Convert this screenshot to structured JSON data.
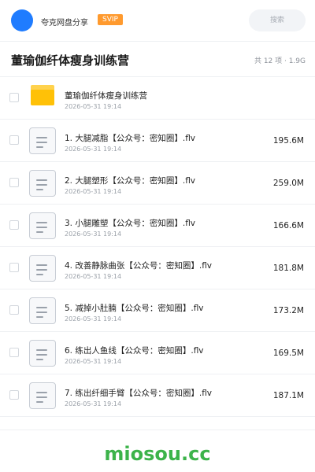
{
  "header": {
    "user_name": "夸克网盘分享",
    "vip_label": "SVIP",
    "search_placeholder": "搜索"
  },
  "title_bar": {
    "title": "董瑜伽纤体瘦身训练营",
    "stats": "共 12 项 · 1.9G"
  },
  "files": [
    {
      "type": "folder",
      "name": "董瑜伽纤体瘦身训练营",
      "date": "2026-05-31 19:14",
      "size": ""
    },
    {
      "type": "file",
      "name": "1. 大腿减脂【公众号：密知圈】.flv",
      "date": "2026-05-31 19:14",
      "size": "195.6M"
    },
    {
      "type": "file",
      "name": "2. 大腿塑形【公众号：密知圈】.flv",
      "date": "2026-05-31 19:14",
      "size": "259.0M"
    },
    {
      "type": "file",
      "name": "3. 小腿雕塑【公众号：密知圈】.flv",
      "date": "2026-05-31 19:14",
      "size": "166.6M"
    },
    {
      "type": "file",
      "name": "4. 改善静脉曲张【公众号：密知圈】.flv",
      "date": "2026-05-31 19:14",
      "size": "181.8M"
    },
    {
      "type": "file",
      "name": "5. 减掉小肚腩【公众号：密知圈】.flv",
      "date": "2026-05-31 19:14",
      "size": "173.2M"
    },
    {
      "type": "file",
      "name": "6. 练出人鱼线【公众号：密知圈】.flv",
      "date": "2026-05-31 19:14",
      "size": "169.5M"
    },
    {
      "type": "file",
      "name": "7. 练出纤细手臂【公众号：密知圈】.flv",
      "date": "2026-05-31 19:14",
      "size": "187.1M"
    }
  ],
  "footer": {
    "watermark": "miosou.cc"
  },
  "colors": {
    "accent": "#1f7cff",
    "vip": "#ff9a2e",
    "folder": "#ffc107",
    "watermark": "#3cb34a"
  }
}
